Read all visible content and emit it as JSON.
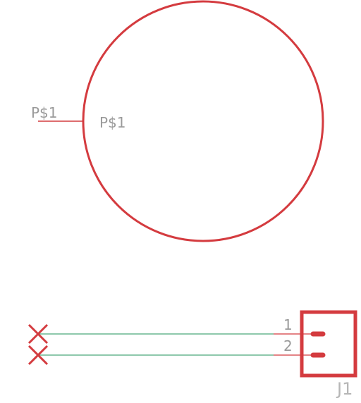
{
  "schematic": {
    "component_circle": {
      "pin_label_outer": "P$1",
      "pin_label_inner": "P$1",
      "color": "#d43b3f"
    },
    "connector": {
      "designator": "J1",
      "pin_numbers": [
        "1",
        "2"
      ],
      "body_color": "#d43b3f",
      "wire_color": "#4aa87a",
      "no_connect_color": "#d43b3f"
    }
  }
}
